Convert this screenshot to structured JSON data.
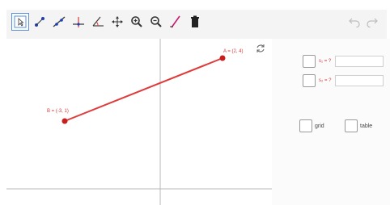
{
  "toolbar": {
    "tools": [
      {
        "icon": "select-arrow-icon",
        "selected": true
      },
      {
        "icon": "point-icon"
      },
      {
        "icon": "line-icon"
      },
      {
        "icon": "perpendicular-icon"
      },
      {
        "icon": "angle-icon"
      },
      {
        "icon": "move-graphics-icon"
      },
      {
        "icon": "zoom-in-icon"
      },
      {
        "icon": "zoom-out-icon"
      },
      {
        "icon": "pen-icon"
      },
      {
        "icon": "delete-icon"
      }
    ],
    "undo_icon": "undo-icon",
    "redo_icon": "redo-icon"
  },
  "graph": {
    "point_a_label": "A = (2, 4)",
    "point_b_label": "B = (-3, 1)",
    "refresh_icon": "refresh-icon",
    "line_color": "#e03a3a"
  },
  "side_panel": {
    "variables": [
      {
        "label": "s₁ = ?"
      },
      {
        "label": "s₂ = ?"
      }
    ],
    "grid_label": "grid",
    "table_label": "table"
  }
}
